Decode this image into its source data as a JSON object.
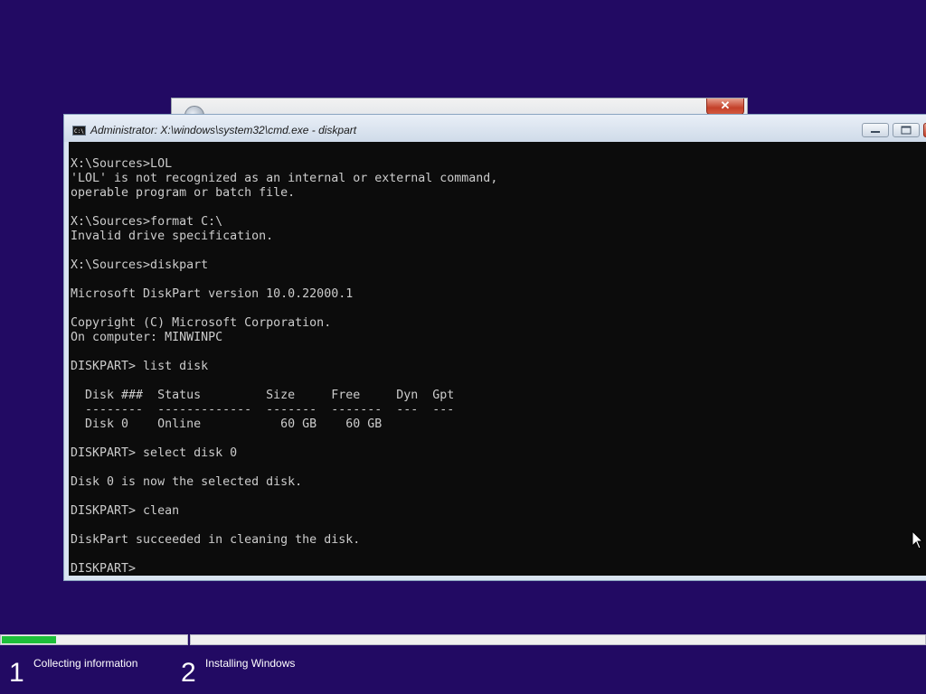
{
  "background_window": {
    "close_label": "✕"
  },
  "cmd_window": {
    "title": "Administrator: X:\\windows\\system32\\cmd.exe - diskpart",
    "icon_text": "C:\\",
    "console_lines": [
      "X:\\Sources>LOL",
      "'LOL' is not recognized as an internal or external command,",
      "operable program or batch file.",
      "",
      "X:\\Sources>format C:\\",
      "Invalid drive specification.",
      "",
      "X:\\Sources>diskpart",
      "",
      "Microsoft DiskPart version 10.0.22000.1",
      "",
      "Copyright (C) Microsoft Corporation.",
      "On computer: MINWINPC",
      "",
      "DISKPART> list disk",
      "",
      "  Disk ###  Status         Size     Free     Dyn  Gpt",
      "  --------  -------------  -------  -------  ---  ---",
      "  Disk 0    Online           60 GB    60 GB",
      "",
      "DISKPART> select disk 0",
      "",
      "Disk 0 is now the selected disk.",
      "",
      "DISKPART> clean",
      "",
      "DiskPart succeeded in cleaning the disk.",
      "",
      "DISKPART> "
    ]
  },
  "setup_footer": {
    "progress": 0.29,
    "steps": [
      {
        "number": "1",
        "label": "Collecting information"
      },
      {
        "number": "2",
        "label": "Installing Windows"
      }
    ]
  },
  "colors": {
    "desktop_bg": "#220a63",
    "console_bg": "#0c0c0c",
    "console_fg": "#cccccc",
    "progress_fill": "#1dbf3a"
  }
}
